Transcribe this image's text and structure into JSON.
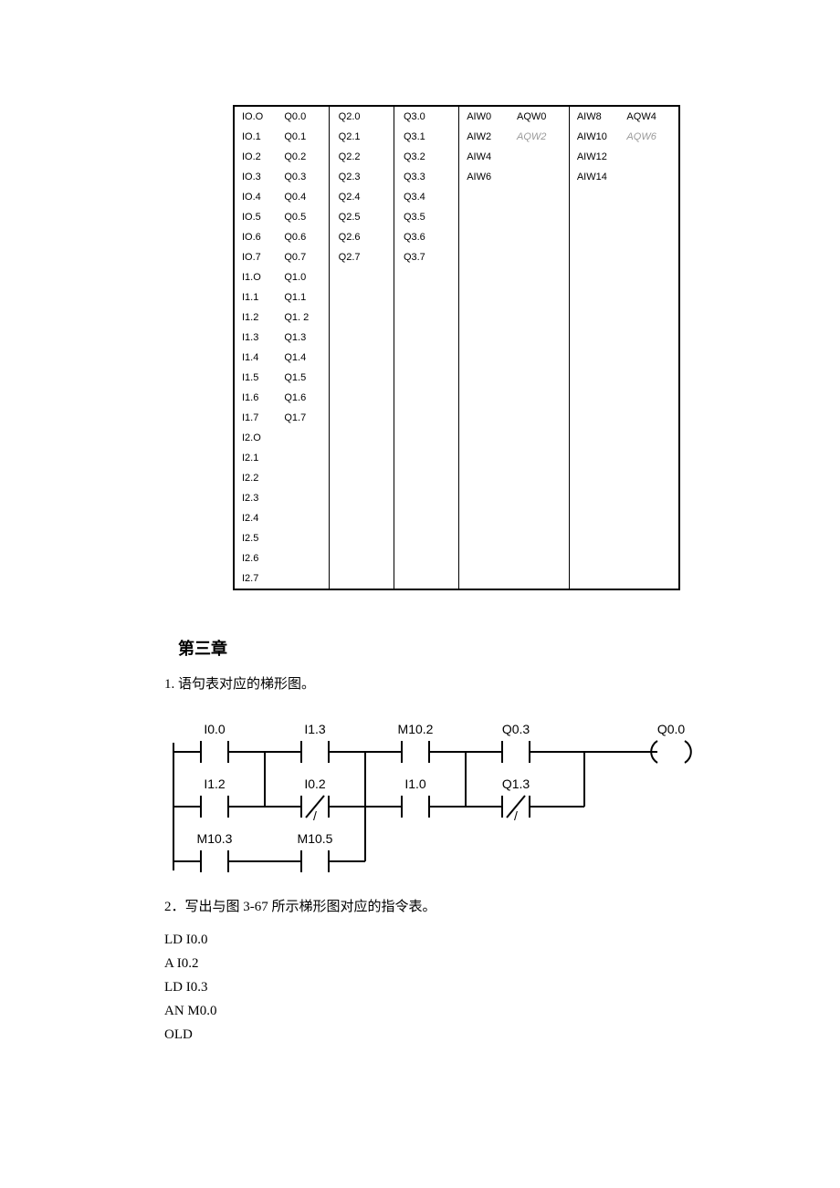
{
  "io_table": {
    "rows": [
      {
        "c1": [
          "IO.O",
          "Q0.0"
        ],
        "c2": "Q2.0",
        "c3": "Q3.0",
        "c4": [
          "AIW0",
          "AQW0"
        ],
        "c5": [
          "AIW8",
          "AQW4"
        ]
      },
      {
        "c1": [
          "IO.1",
          "Q0.1"
        ],
        "c2": "Q2.1",
        "c3": "Q3.1",
        "c4": [
          "AIW2",
          "AQW2"
        ],
        "c4_faded": true,
        "c5": [
          "AIW10",
          "AQW6"
        ],
        "c5_faded": true
      },
      {
        "c1": [
          "IO.2",
          "Q0.2"
        ],
        "c2": "Q2.2",
        "c3": "Q3.2",
        "c4": [
          "AIW4",
          ""
        ],
        "c5": [
          "AIW12",
          ""
        ]
      },
      {
        "c1": [
          "IO.3",
          "Q0.3"
        ],
        "c2": "Q2.3",
        "c3": "Q3.3",
        "c4": [
          "AIW6",
          ""
        ],
        "c5": [
          "AIW14",
          ""
        ]
      },
      {
        "c1": [
          "IO.4",
          "Q0.4"
        ],
        "c2": "Q2.4",
        "c3": "Q3.4",
        "c4": [
          "",
          ""
        ],
        "c5": [
          "",
          ""
        ]
      },
      {
        "c1": [
          "IO.5",
          "Q0.5"
        ],
        "c2": "Q2.5",
        "c3": "Q3.5",
        "c4": [
          "",
          ""
        ],
        "c5": [
          "",
          ""
        ]
      },
      {
        "c1": [
          "IO.6",
          "Q0.6"
        ],
        "c2": "Q2.6",
        "c3": "Q3.6",
        "c4": [
          "",
          ""
        ],
        "c5": [
          "",
          ""
        ]
      },
      {
        "c1": [
          "IO.7",
          "Q0.7"
        ],
        "c2": "Q2.7",
        "c3": "Q3.7",
        "c4": [
          "",
          ""
        ],
        "c5": [
          "",
          ""
        ]
      },
      {
        "c1": [
          "I1.O",
          "Q1.0"
        ],
        "c2": "",
        "c3": "",
        "c4": [
          "",
          ""
        ],
        "c5": [
          "",
          ""
        ]
      },
      {
        "c1": [
          "I1.1",
          "Q1.1"
        ],
        "c2": "",
        "c3": "",
        "c4": [
          "",
          ""
        ],
        "c5": [
          "",
          ""
        ]
      },
      {
        "c1": [
          "I1.2",
          "Q1. 2"
        ],
        "c2": "",
        "c3": "",
        "c4": [
          "",
          ""
        ],
        "c5": [
          "",
          ""
        ]
      },
      {
        "c1": [
          "I1.3",
          "Q1.3"
        ],
        "c2": "",
        "c3": "",
        "c4": [
          "",
          ""
        ],
        "c5": [
          "",
          ""
        ]
      },
      {
        "c1": [
          "I1.4",
          "Q1.4"
        ],
        "c2": "",
        "c3": "",
        "c4": [
          "",
          ""
        ],
        "c5": [
          "",
          ""
        ]
      },
      {
        "c1": [
          "I1.5",
          "Q1.5"
        ],
        "c2": "",
        "c3": "",
        "c4": [
          "",
          ""
        ],
        "c5": [
          "",
          ""
        ]
      },
      {
        "c1": [
          "I1.6",
          "Q1.6"
        ],
        "c2": "",
        "c3": "",
        "c4": [
          "",
          ""
        ],
        "c5": [
          "",
          ""
        ]
      },
      {
        "c1": [
          "I1.7",
          "Q1.7"
        ],
        "c2": "",
        "c3": "",
        "c4": [
          "",
          ""
        ],
        "c5": [
          "",
          ""
        ]
      },
      {
        "c1": [
          "I2.O",
          ""
        ],
        "c2": "",
        "c3": "",
        "c4": [
          "",
          ""
        ],
        "c5": [
          "",
          ""
        ]
      },
      {
        "c1": [
          "I2.1",
          ""
        ],
        "c2": "",
        "c3": "",
        "c4": [
          "",
          ""
        ],
        "c5": [
          "",
          ""
        ]
      },
      {
        "c1": [
          "I2.2",
          ""
        ],
        "c2": "",
        "c3": "",
        "c4": [
          "",
          ""
        ],
        "c5": [
          "",
          ""
        ]
      },
      {
        "c1": [
          "I2.3",
          ""
        ],
        "c2": "",
        "c3": "",
        "c4": [
          "",
          ""
        ],
        "c5": [
          "",
          ""
        ]
      },
      {
        "c1": [
          "I2.4",
          ""
        ],
        "c2": "",
        "c3": "",
        "c4": [
          "",
          ""
        ],
        "c5": [
          "",
          ""
        ]
      },
      {
        "c1": [
          "I2.5",
          ""
        ],
        "c2": "",
        "c3": "",
        "c4": [
          "",
          ""
        ],
        "c5": [
          "",
          ""
        ]
      },
      {
        "c1": [
          "I2.6",
          ""
        ],
        "c2": "",
        "c3": "",
        "c4": [
          "",
          ""
        ],
        "c5": [
          "",
          ""
        ]
      },
      {
        "c1": [
          "I2.7",
          ""
        ],
        "c2": "",
        "c3": "",
        "c4": [
          "",
          ""
        ],
        "c5": [
          "",
          ""
        ]
      }
    ]
  },
  "chapter_title": "第三章",
  "item1": "1.  语句表对应的梯形图。",
  "item2": "2．写出与图 3-67 所示梯形图对应的指令表。",
  "ladder": {
    "rung1": [
      "I0.0",
      "I1.3",
      "M10.2",
      "Q0.3"
    ],
    "rung1_out": "Q0.0",
    "rung2": [
      "I1.2",
      "I0.2",
      "I1.0",
      "Q1.3"
    ],
    "rung2_nc": [
      false,
      true,
      false,
      true
    ],
    "rung3": [
      "M10.3",
      "M10.5"
    ]
  },
  "instructions": [
    "LD I0.0",
    "A I0.2",
    "LD I0.3",
    "AN M0.0",
    "OLD"
  ]
}
